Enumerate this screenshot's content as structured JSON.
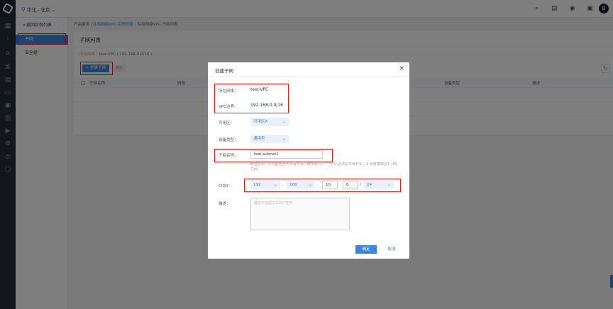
{
  "topbar": {
    "region": "华北 - 北京",
    "icons": [
      "search-icon",
      "document-icon",
      "support-icon",
      "console-icon"
    ],
    "avatar_letter": "B"
  },
  "rail": {
    "icons": [
      "home-icon",
      "chevron-right-icon",
      "building-icon",
      "network-icon",
      "grid-icon",
      "storage-icon",
      "image-icon",
      "server-icon",
      "play-icon",
      "settings-icon",
      "security-icon",
      "monitor-icon"
    ]
  },
  "sidebar": {
    "back_label": "<返回实例列表",
    "items": [
      {
        "label": "子网",
        "active": true
      },
      {
        "label": "安全组",
        "active": false
      }
    ]
  },
  "breadcrumb": {
    "root": "产品服务",
    "sep": " / ",
    "level1": "私有网络VPC-实例列表",
    "level2": "私有网络VPC-子网列表"
  },
  "list": {
    "title": "子网列表",
    "vpc_key": "所在网络：",
    "vpc_value": "test-VPC ( 192.168.0.0/16 )",
    "create_button": "+ 创建子网",
    "delete_button": "删除",
    "columns": [
      "子网名称",
      "网段",
      "设备类型",
      "描述"
    ]
  },
  "dialog": {
    "title": "创建子网",
    "close_glyph": "×",
    "network_label": "所在网络：",
    "network_value": "test-VPC",
    "vpc_cidr_label": "VPC边界：",
    "vpc_cidr_value": "192.168.0.0/16",
    "zone_label": "可用区：",
    "zone_value": "可用区A",
    "device_label": "设备类型：",
    "device_value": "通用型",
    "name_label": "子网名称：",
    "name_value": "test-subnet1",
    "name_hint": "命名规范：1.只能包含大小写字母，数字和\"-\"，\"_\"；2.必须以字母开头；3.长度限制在1~65之间。",
    "cidr_label": "CIDR：",
    "cidr_octet1": "192",
    "cidr_octet2": "168",
    "cidr_octet3": "10",
    "cidr_octet4": "0",
    "cidr_mask": "24",
    "cidr_dot": ".",
    "cidr_slash": "/",
    "desc_label": "描述：",
    "desc_placeholder": "描述不能超过200个字符",
    "ok_button": "确定",
    "cancel_button": "取消"
  },
  "colors": {
    "accent": "#3b86e0",
    "highlight": "#e02020",
    "rail": "#262d3a"
  }
}
